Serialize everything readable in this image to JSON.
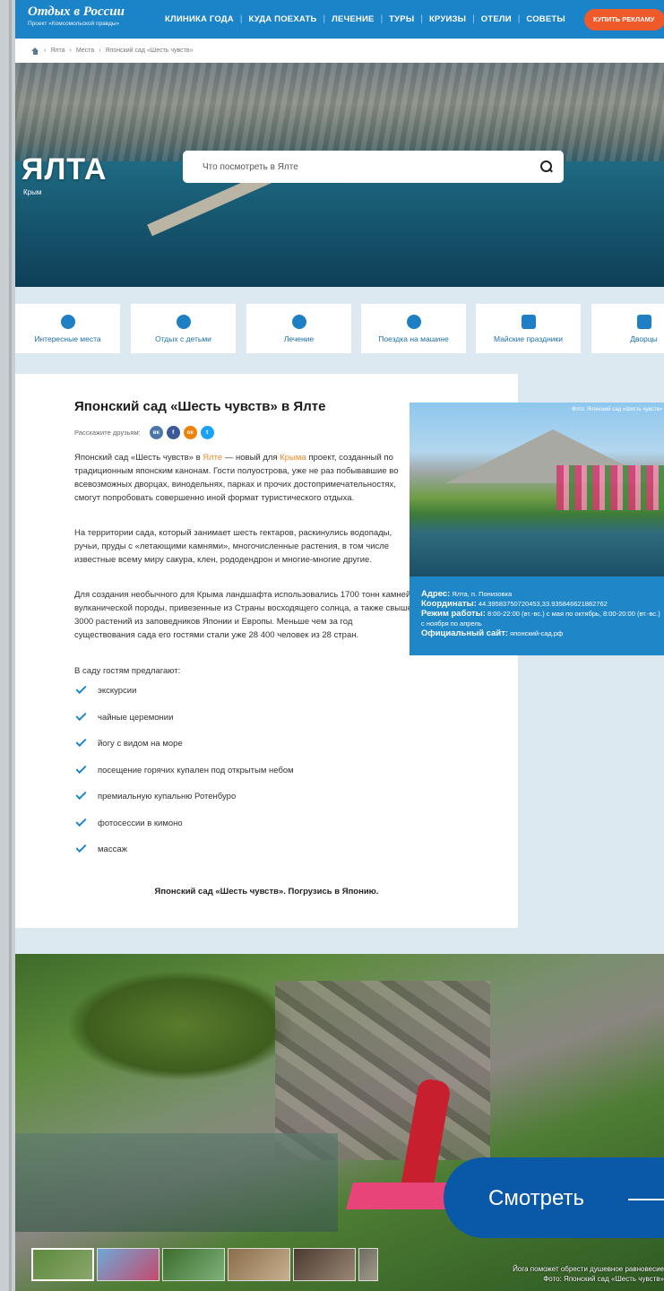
{
  "header": {
    "logo_title": "Отдых в России",
    "logo_subtitle": "Проект «Комсомольской правды»",
    "nav": [
      "КЛИНИКА ГОДА",
      "КУДА ПОЕХАТЬ",
      "ЛЕЧЕНИЕ",
      "ТУРЫ",
      "КРУИЗЫ",
      "ОТЕЛИ",
      "СОВЕТЫ"
    ],
    "buy_label": "КУПИТЬ РЕКЛАМУ"
  },
  "breadcrumbs": [
    "Ялта",
    "Места",
    "Японский сад «Шесть чувств»"
  ],
  "hero": {
    "city": "ЯЛТА",
    "region": "Крым",
    "search_placeholder": "Что посмотреть в Ялте"
  },
  "categories": [
    {
      "label": "Интересные места",
      "icon": "map-pin-icon"
    },
    {
      "label": "Отдых с детьми",
      "icon": "teddy-bear-icon"
    },
    {
      "label": "Лечение",
      "icon": "heart-pulse-icon"
    },
    {
      "label": "Поездка на машине",
      "icon": "car-icon"
    },
    {
      "label": "Майские праздники",
      "icon": "gift-icon"
    },
    {
      "label": "Дворцы",
      "icon": "palace-icon"
    }
  ],
  "article": {
    "title": "Японский сад «Шесть чувств» в Ялте",
    "share_label": "Расскажите друзьям:",
    "social": [
      "вк",
      "f",
      "ок",
      "t"
    ],
    "p1_a": "Японский сад «Шесть чувств» в ",
    "p1_link1": "Ялте",
    "p1_b": " — новый для ",
    "p1_link2": "Крыма",
    "p1_c": " проект, созданный по традиционным японским канонам. Гости полуострова, уже не раз побывавшие во всевозможных дворцах, винодельнях, парках и прочих достопримечательностях, смогут попробовать совершенно иной формат туристического отдыха.",
    "p2": "На территории сада, который занимает шесть гектаров, раскинулись водопады, ручьи, пруды с «летающими камнями», многочисленные растения, в том числе известные всему миру сакура, клен, рододендрон и многие-многие другие.",
    "p3": "Для создания необычного для Крыма ландшафта использовались 1700 тонн камней вулканической породы, привезенные из Страны восходящего солнца, а также свыше 3000 растений из заповедников Японии и Европы. Меньше чем за год существования сада его гостями стали уже 28 400 человек из 28 стран.",
    "p4": "В саду гостям предлагают:",
    "offers": [
      "экскурсии",
      "чайные церемонии",
      "йогу с видом на море",
      "посещение горячих купален под открытым небом",
      "премиальную купальню Ротенбуро",
      "фотосессии в кимоно",
      "массаж"
    ],
    "tagline": "Японский сад «Шесть чувств». Погрузись в Японию."
  },
  "sidecard": {
    "photo_credit": "Фото: Японский сад «Шесть чувств»",
    "address_label": "Адрес:",
    "address": "Ялта, п. Понизовка",
    "coords_label": "Координаты:",
    "coords": "44.39583750720453,33.935846621882762",
    "hours_label": "Режим работы:",
    "hours": "8:00-22:00 (вт.-вс.) с мая по октябрь, 8:00-20:00 (вт.-вс.) с ноября по апрель",
    "site_label": "Официальный сайт:",
    "site": "японский-сад.рф"
  },
  "gallery": {
    "watch_label": "Смотреть",
    "caption": "Йога поможет обрести душевное равновесие",
    "credit": "Фото: Японский сад «Шесть чувств»",
    "thumb_count": 6
  },
  "colors": {
    "brand": "#1b83c8",
    "accent": "#ef5a2b",
    "link": "#ef8a2b",
    "info": "#1f86c8",
    "watch": "#0a58a8"
  }
}
